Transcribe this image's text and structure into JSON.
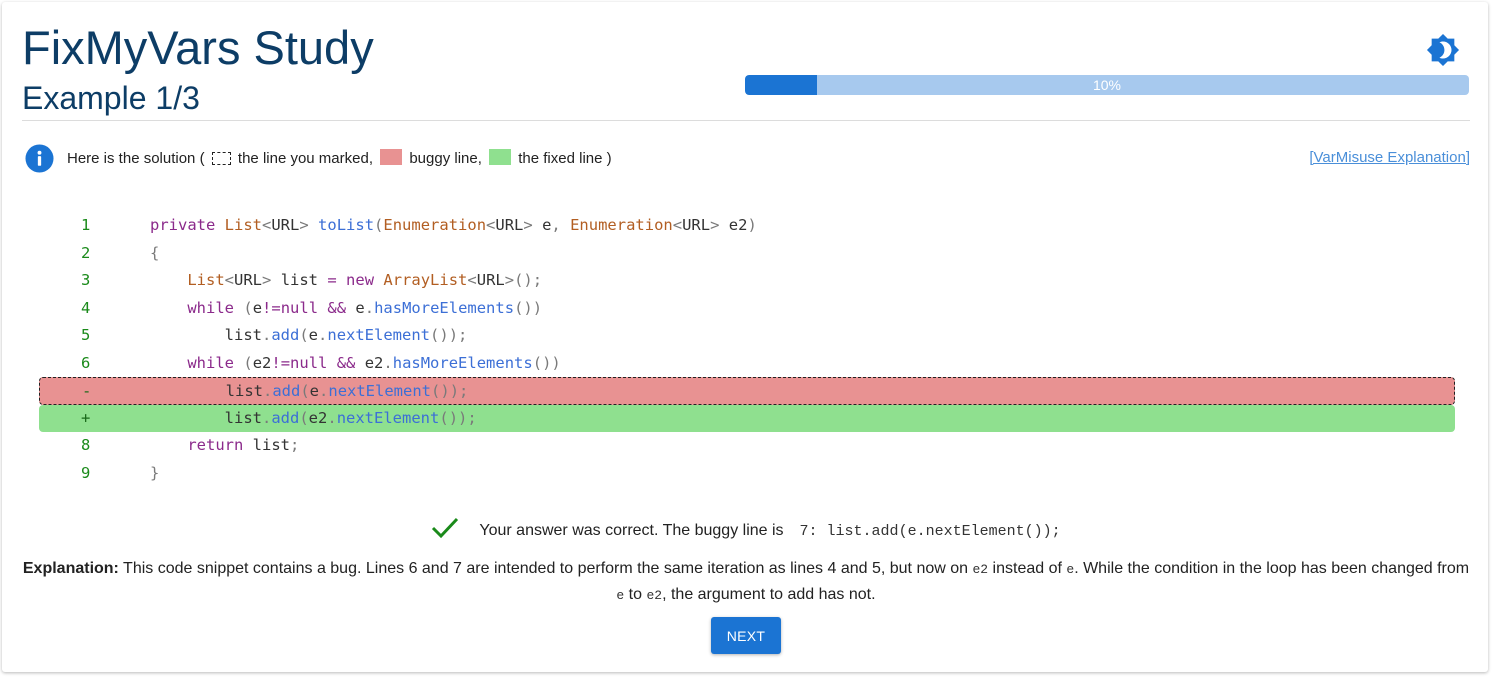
{
  "header": {
    "title": "FixMyVars Study",
    "subtitle": "Example 1/3",
    "theme_toggle_icon": "brightness-icon"
  },
  "progress": {
    "value_percent": 10,
    "label": "10%",
    "colors": {
      "fill": "#1b74d3",
      "track": "#a7c9ee"
    }
  },
  "info": {
    "icon": "info-icon",
    "prefix": "Here is the solution (",
    "marked_label": "the line you marked,",
    "buggy_label": "buggy line,",
    "fixed_label": "the fixed line )",
    "link": "[VarMisuse Explanation]"
  },
  "colors": {
    "title": "#0d3d66",
    "accent": "#1b74d3",
    "buggy": "#e89292",
    "fixed": "#8fe08f",
    "line_number": "#1a8a1a"
  },
  "code": {
    "lines": [
      {
        "num": "1",
        "kind": "normal",
        "text": "private List<URL> toList(Enumeration<URL> e, Enumeration<URL> e2)"
      },
      {
        "num": "2",
        "kind": "normal",
        "text": "{"
      },
      {
        "num": "3",
        "kind": "normal",
        "text": "    List<URL> list = new ArrayList<URL>();"
      },
      {
        "num": "4",
        "kind": "normal",
        "text": "    while (e!=null && e.hasMoreElements())"
      },
      {
        "num": "5",
        "kind": "normal",
        "text": "        list.add(e.nextElement());"
      },
      {
        "num": "6",
        "kind": "normal",
        "text": "    while (e2!=null && e2.hasMoreElements())"
      },
      {
        "num": "-",
        "kind": "removed",
        "text": "        list.add(e.nextElement());"
      },
      {
        "num": "+",
        "kind": "added",
        "text": "        list.add(e2.nextElement());"
      },
      {
        "num": "8",
        "kind": "normal",
        "text": "    return list;"
      },
      {
        "num": "9",
        "kind": "normal",
        "text": "}"
      }
    ]
  },
  "result": {
    "icon": "check-icon",
    "message": "Your answer was correct. The buggy line is",
    "line_code": "7: list.add(e.nextElement());"
  },
  "explanation": {
    "label": "Explanation:",
    "text_1": " This code snippet contains a bug. Lines 6 and 7 are intended to perform the same iteration as lines 4 and 5, but now on ",
    "code_1": "e2",
    "text_2": " instead of ",
    "code_2": "e",
    "text_3": ". While the condition in the loop has been changed from ",
    "code_3": "e",
    "text_4": " to ",
    "code_4": "e2",
    "text_5": ", the argument to add has not."
  },
  "next_button": {
    "label": "NEXT"
  }
}
